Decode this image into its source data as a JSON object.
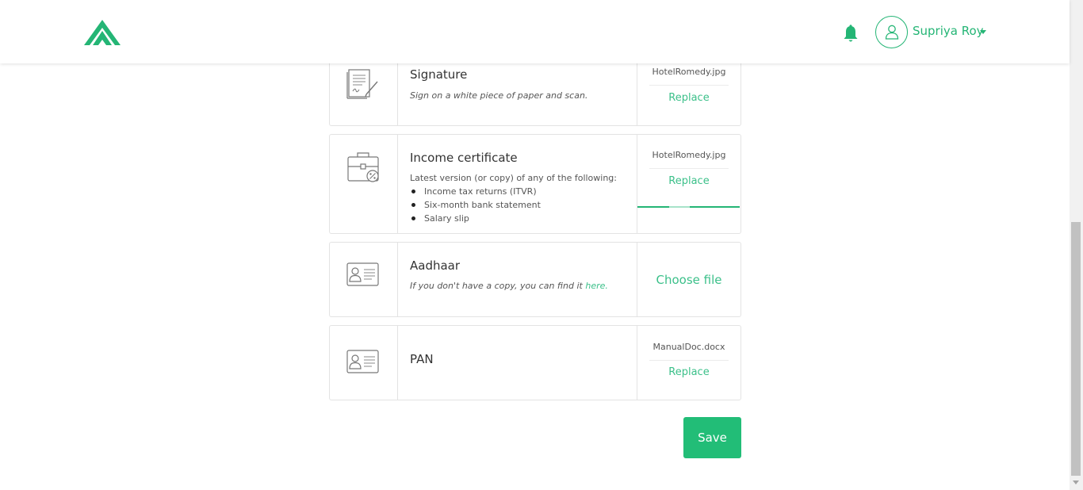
{
  "header": {
    "user_name": "Supriya Roy",
    "brand_color": "#24b575"
  },
  "documents": [
    {
      "title": "Signature",
      "subtitle": "Sign on a white piece of paper and scan.",
      "file_name": "HotelRomedy.jpg",
      "action": "Replace",
      "icon": "signature-document-icon"
    },
    {
      "title": "Income certificate",
      "description": "Latest version (or copy) of any of the following:",
      "items": [
        "Income tax returns (ITVR)",
        "Six-month bank statement",
        "Salary slip"
      ],
      "file_name": "HotelRomedy.jpg",
      "action": "Replace",
      "icon": "briefcase-percent-icon"
    },
    {
      "title": "Aadhaar",
      "subtitle_prefix": "If you don't have a copy, you can find it ",
      "subtitle_link": "here.",
      "action": "Choose file",
      "icon": "id-card-icon"
    },
    {
      "title": "PAN",
      "file_name": "ManualDoc.docx",
      "action": "Replace",
      "icon": "id-card-icon"
    }
  ],
  "save_label": "Save"
}
